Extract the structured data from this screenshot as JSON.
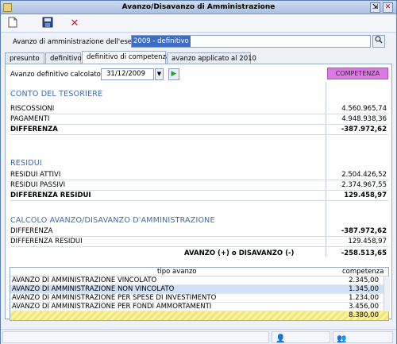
{
  "window": {
    "title": "Avanzo/Disavanzo di Amministrazione"
  },
  "toolbar": {
    "new_icon": "new-document-icon",
    "save_icon": "floppy-disk-icon",
    "delete_icon": "red-x-icon"
  },
  "esercizio": {
    "label": "Avanzo di amministrazione dell'esercizio:",
    "value": "2009 - definitivo"
  },
  "tabs": [
    {
      "label": "presunto"
    },
    {
      "label": "definitivo"
    },
    {
      "label": "definitivo di competenza"
    },
    {
      "label": "avanzo applicato al 2010"
    }
  ],
  "calc": {
    "label": "Avanzo definitivo calcolato al:",
    "date": "31/12/2009",
    "badge": "COMPETENZA"
  },
  "tesoriere": {
    "title": "CONTO DEL TESORIERE",
    "riscossioni_label": "RISCOSSIONI",
    "riscossioni_value": "4.560.965,74",
    "pagamenti_label": "PAGAMENTI",
    "pagamenti_value": "4.948.938,36",
    "differenza_label": "DIFFERENZA",
    "differenza_value": "-387.972,62"
  },
  "residui": {
    "title": "RESIDUI",
    "attivi_label": "RESIDUI ATTIVI",
    "attivi_value": "2.504.426,52",
    "passivi_label": "RESIDUI PASSIVI",
    "passivi_value": "2.374.967,55",
    "diff_label": "DIFFERENZA RESIDUI",
    "diff_value": "129.458,97"
  },
  "calcolo": {
    "title": "CALCOLO AVANZO/DISAVANZO D'AMMINISTRAZIONE",
    "differenza_label": "DIFFERENZA",
    "differenza_value": "-387.972,62",
    "diff_residui_label": "DIFFERENZA RESIDUI",
    "diff_residui_value": "129.458,97",
    "avanzo_label": "AVANZO (+) o DISAVANZO (-)",
    "avanzo_value": "-258.513,65"
  },
  "table": {
    "col_tipo": "tipo avanzo",
    "col_comp": "competenza",
    "rows": [
      {
        "tipo": "AVANZO DI AMMINISTRAZIONE VINCOLATO",
        "comp": "2.345,00"
      },
      {
        "tipo": "AVANZO DI AMMINISTRAZIONE NON VINCOLATO",
        "comp": "1.345,00"
      },
      {
        "tipo": "AVANZO DI AMMINISTRAZIONE PER SPESE DI INVESTIMENTO",
        "comp": "1.234,00"
      },
      {
        "tipo": "AVANZO DI AMMINISTRAZIONE PER FONDI AMMORTAMENTI",
        "comp": "3.456,00"
      }
    ],
    "total": "8.380,00"
  }
}
